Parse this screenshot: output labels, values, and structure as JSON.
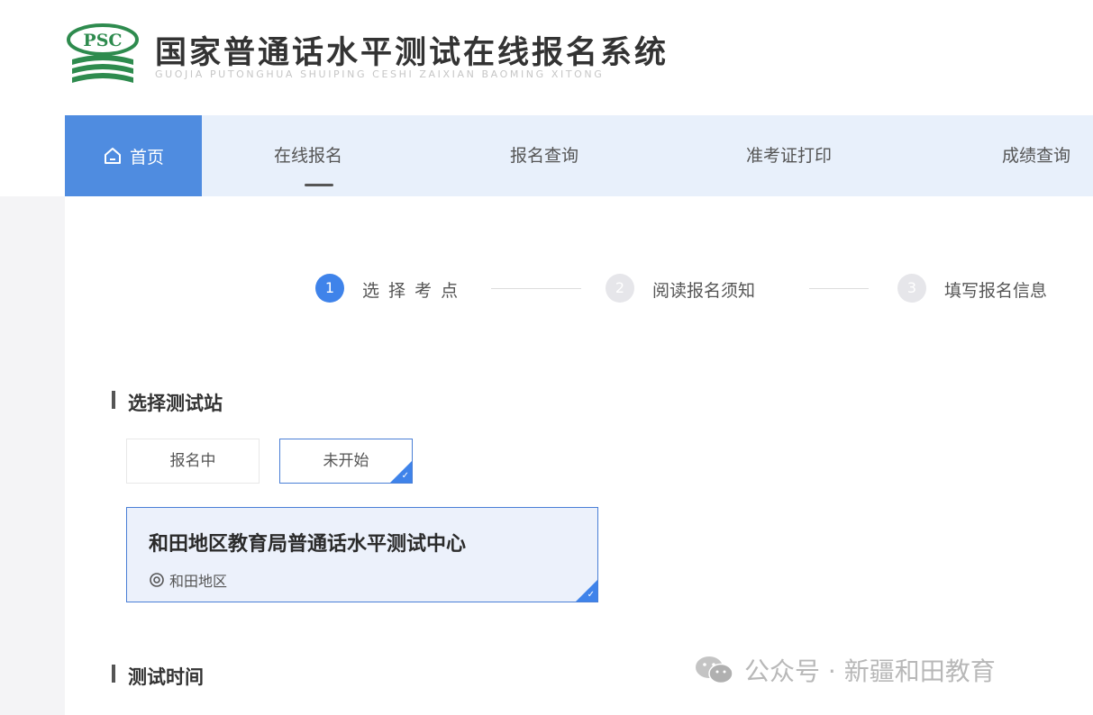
{
  "header": {
    "logo_text": "PSC",
    "title": "国家普通话水平测试在线报名系统",
    "subtitle": "GUOJIA PUTONGHUA SHUIPING CESHI ZAIXIAN BAOMING XITONG"
  },
  "nav": {
    "home_label": "首页",
    "items": [
      {
        "label": "在线报名"
      },
      {
        "label": "报名查询"
      },
      {
        "label": "准考证打印"
      },
      {
        "label": "成绩查询"
      }
    ],
    "active_color": "#4f8ce0"
  },
  "steps": [
    {
      "number": "1",
      "label": "选 择 考 点",
      "state": "active"
    },
    {
      "number": "2",
      "label": "阅读报名须知",
      "state": "inactive"
    },
    {
      "number": "3",
      "label": "填写报名信息",
      "state": "inactive"
    }
  ],
  "section_station": {
    "title": "选择测试站",
    "status_tabs": [
      {
        "label": "报名中",
        "selected": false
      },
      {
        "label": "未开始",
        "selected": true
      }
    ],
    "center": {
      "name": "和田地区教育局普通话水平测试中心",
      "location": "和田地区"
    }
  },
  "section_time": {
    "title": "测试时间"
  },
  "watermark": {
    "text": "公众号 · 新疆和田教育"
  },
  "colors": {
    "accent": "#3f83ea",
    "nav_bg": "#e8f0fb",
    "logo_green": "#2e8b4e"
  }
}
